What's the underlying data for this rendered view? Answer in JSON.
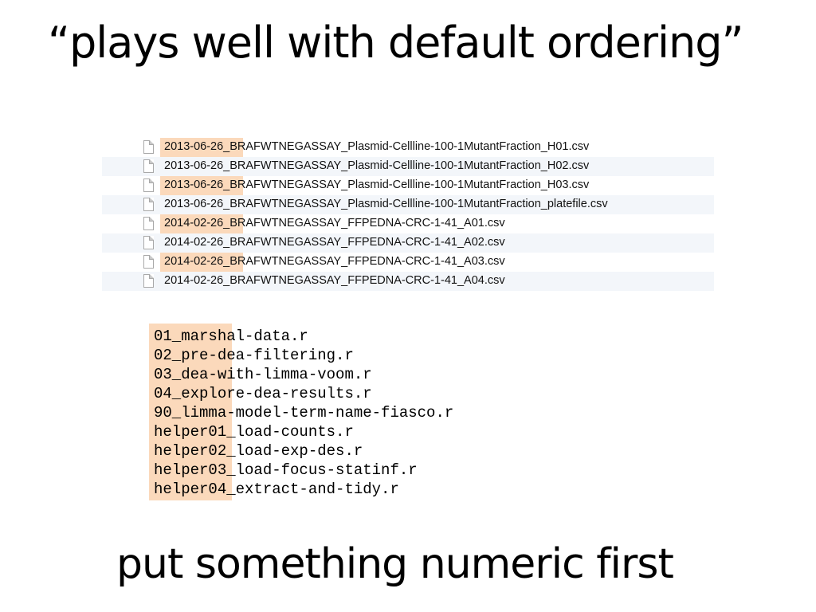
{
  "title": "“plays well with default ordering”",
  "files": [
    "2013-06-26_BRAFWTNEGASSAY_Plasmid-Cellline-100-1MutantFraction_H01.csv",
    "2013-06-26_BRAFWTNEGASSAY_Plasmid-Cellline-100-1MutantFraction_H02.csv",
    "2013-06-26_BRAFWTNEGASSAY_Plasmid-Cellline-100-1MutantFraction_H03.csv",
    "2013-06-26_BRAFWTNEGASSAY_Plasmid-Cellline-100-1MutantFraction_platefile.csv",
    "2014-02-26_BRAFWTNEGASSAY_FFPEDNA-CRC-1-41_A01.csv",
    "2014-02-26_BRAFWTNEGASSAY_FFPEDNA-CRC-1-41_A02.csv",
    "2014-02-26_BRAFWTNEGASSAY_FFPEDNA-CRC-1-41_A03.csv",
    "2014-02-26_BRAFWTNEGASSAY_FFPEDNA-CRC-1-41_A04.csv"
  ],
  "file_icon": "document-icon",
  "scripts": [
    "01_marshal-data.r",
    "02_pre-dea-filtering.r",
    "03_dea-with-limma-voom.r",
    "04_explore-dea-results.r",
    "90_limma-model-term-name-fiasco.r",
    "helper01_load-counts.r",
    "helper02_load-exp-des.r",
    "helper03_load-focus-statinf.r",
    "helper04_extract-and-tidy.r"
  ],
  "subtitle": "put something numeric first",
  "colors": {
    "highlight": "#fbd9bb",
    "row_stripe": "#f3f6fa",
    "text": "#000000"
  }
}
